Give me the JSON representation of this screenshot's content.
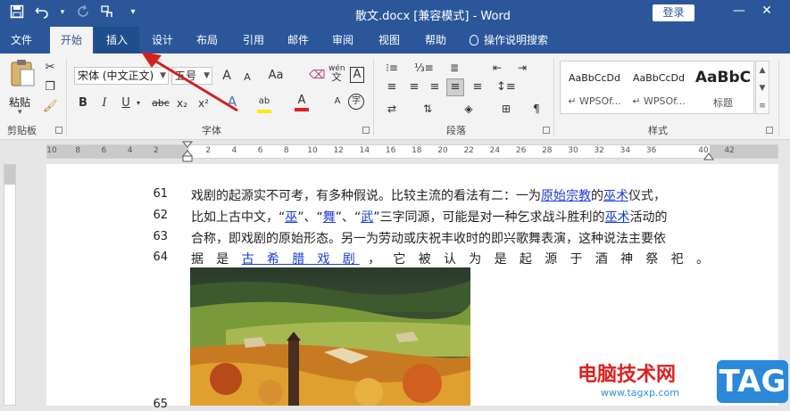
{
  "window": {
    "title": "散文.docx [兼容模式] - Word",
    "login_label": "登录",
    "minimize_glyph": "—",
    "close_glyph": "✕"
  },
  "quick_access": {
    "save_icon": "save-icon",
    "undo_icon": "undo-icon",
    "redo_icon": "redo-icon",
    "touch_icon": "touch-mode-icon",
    "customize_icon": "customize-icon"
  },
  "tabs": [
    {
      "label": "文件"
    },
    {
      "label": "开始"
    },
    {
      "label": "插入"
    },
    {
      "label": "设计"
    },
    {
      "label": "布局"
    },
    {
      "label": "引用"
    },
    {
      "label": "邮件"
    },
    {
      "label": "审阅"
    },
    {
      "label": "视图"
    },
    {
      "label": "帮助"
    },
    {
      "label": "操作说明搜索"
    }
  ],
  "ribbon": {
    "clipboard": {
      "paste_label": "粘贴",
      "group_label": "剪贴板"
    },
    "font": {
      "font_name": "宋体 (中文正文)",
      "font_size": "五号",
      "group_label": "字体",
      "bold": "B",
      "italic": "I",
      "underline": "U",
      "strike": "abc",
      "subscript": "x₂",
      "superscript": "x²",
      "grow": "A",
      "shrink": "A",
      "case": "Aa",
      "phonetic": "wén",
      "phonetic_sub": "文",
      "border_char": "A",
      "font_color": "A",
      "circled": "字"
    },
    "paragraph": {
      "group_label": "段落"
    },
    "styles": {
      "group_label": "样式",
      "items": [
        {
          "preview": "AaBbCcDd",
          "name": "↵ WPSOf..."
        },
        {
          "preview": "AaBbCcDd",
          "name": "↵ WPSOf..."
        },
        {
          "preview": "AaBbC",
          "name": "标题"
        }
      ]
    }
  },
  "ruler": {
    "numbers": [
      "10",
      "8",
      "6",
      "4",
      "2",
      "",
      "2",
      "4",
      "6",
      "8",
      "10",
      "12",
      "14",
      "16",
      "18",
      "20",
      "22",
      "24",
      "26",
      "28",
      "30",
      "32",
      "34",
      "36",
      "",
      "40",
      "42"
    ]
  },
  "document": {
    "lines": [
      {
        "num": "61",
        "parts": [
          {
            "text": "戏剧的起源实不可考，有多种假说。比较主流的看法有二：一为",
            "link": false
          },
          {
            "text": "原始宗教",
            "link": true
          },
          {
            "text": "的",
            "link": false
          },
          {
            "text": "巫术",
            "link": true
          },
          {
            "text": "仪式，",
            "link": false
          }
        ]
      },
      {
        "num": "62",
        "parts": [
          {
            "text": "比如上古中文，“",
            "link": false
          },
          {
            "text": "巫",
            "link": true
          },
          {
            "text": "”、“",
            "link": false
          },
          {
            "text": "舞",
            "link": true
          },
          {
            "text": "”、“",
            "link": false
          },
          {
            "text": "武",
            "link": true
          },
          {
            "text": "”三字同源，可能是对一种乞求战斗胜利的",
            "link": false
          },
          {
            "text": "巫术",
            "link": true
          },
          {
            "text": "活动的",
            "link": false
          }
        ]
      },
      {
        "num": "63",
        "parts": [
          {
            "text": "合称，即戏剧的原始形态。另一为劳动或庆祝丰收时的即兴歌舞表演，这种说法主要依",
            "link": false
          }
        ]
      },
      {
        "num": "64",
        "parts": [
          {
            "text": "据 是 ",
            "link": false
          },
          {
            "text": "古 希 腊 戏 剧",
            "link": true
          },
          {
            "text": " ， 它 被 认 为 是 起 源 于 酒 神 祭 祀 。",
            "link": false
          }
        ]
      },
      {
        "num": "65",
        "parts": []
      }
    ]
  },
  "watermark": {
    "cn": "电脑技术网",
    "url": "www.tagxp.com",
    "tag": "TAG"
  },
  "annotation": {
    "arrow_color": "#d42020"
  }
}
